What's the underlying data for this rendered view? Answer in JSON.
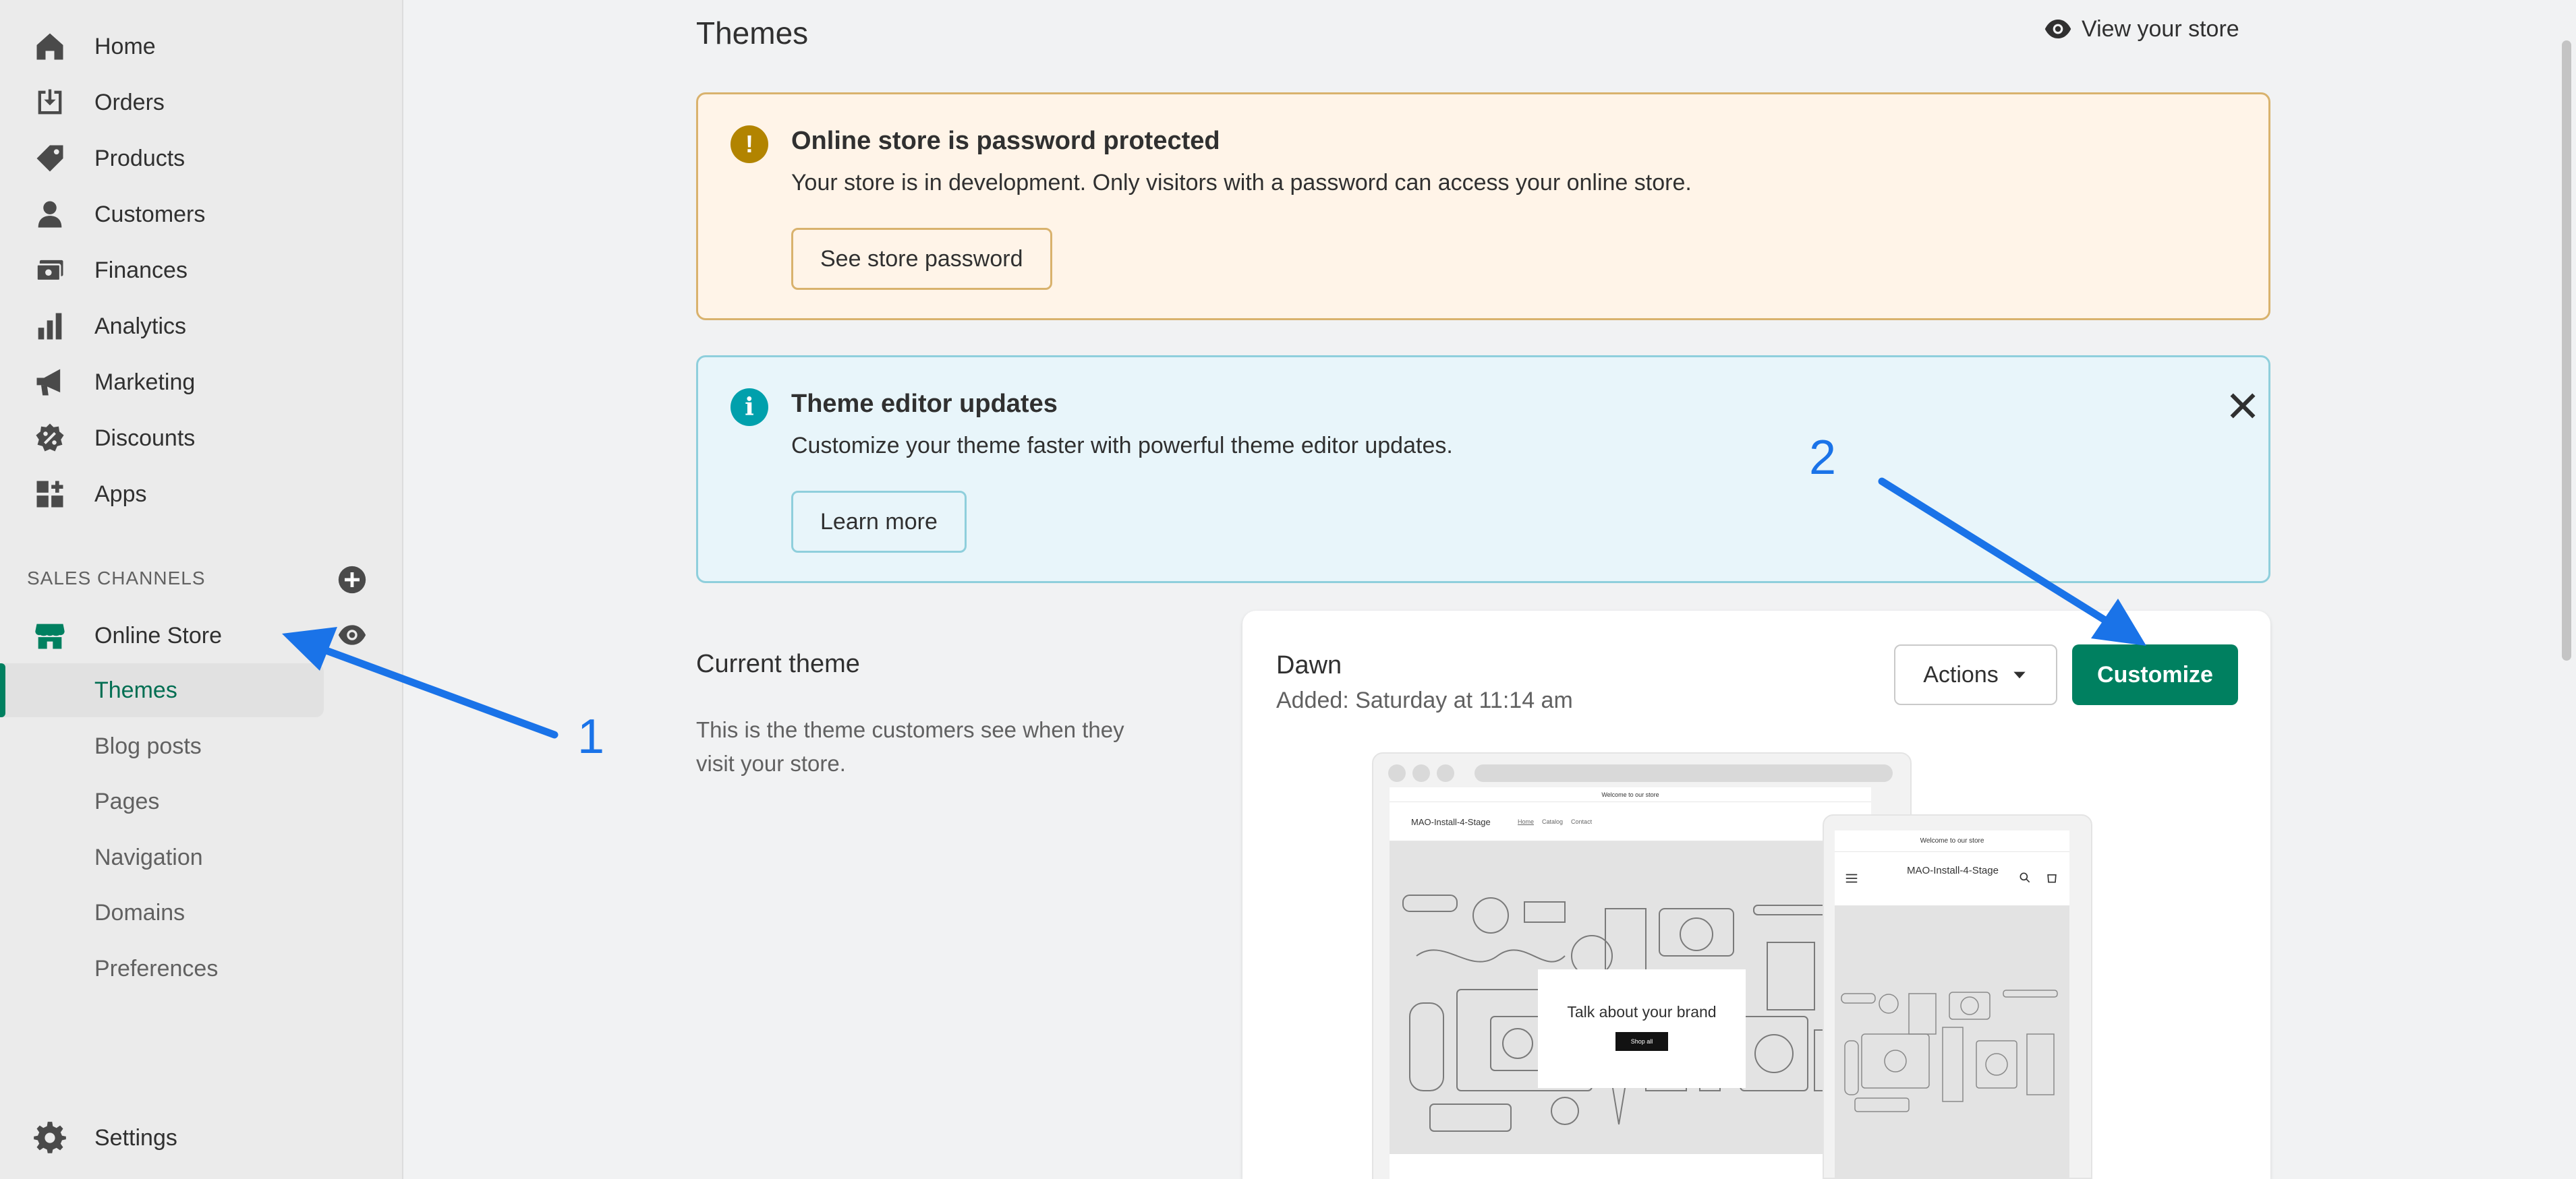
{
  "sidebar": {
    "nav": [
      {
        "label": "Home",
        "icon": "home-icon"
      },
      {
        "label": "Orders",
        "icon": "orders-icon"
      },
      {
        "label": "Products",
        "icon": "tag-icon"
      },
      {
        "label": "Customers",
        "icon": "person-icon"
      },
      {
        "label": "Finances",
        "icon": "finances-icon"
      },
      {
        "label": "Analytics",
        "icon": "bar-chart-icon"
      },
      {
        "label": "Marketing",
        "icon": "megaphone-icon"
      },
      {
        "label": "Discounts",
        "icon": "discount-icon"
      },
      {
        "label": "Apps",
        "icon": "apps-icon"
      }
    ],
    "sales_channels_label": "SALES CHANNELS",
    "online_store_label": "Online Store",
    "sub_items": [
      "Themes",
      "Blog posts",
      "Pages",
      "Navigation",
      "Domains",
      "Preferences"
    ],
    "active_sub_item": "Themes",
    "settings_label": "Settings"
  },
  "header": {
    "title": "Themes",
    "view_store_label": "View your store"
  },
  "password_banner": {
    "title": "Online store is password protected",
    "text": "Your store is in development. Only visitors with a password can access your online store.",
    "button": "See store password",
    "icon": "alert-icon",
    "icon_color": "#b28400"
  },
  "editor_banner": {
    "title": "Theme editor updates",
    "text": "Customize your theme faster with powerful theme editor updates.",
    "button": "Learn more",
    "icon": "info-icon",
    "icon_color": "#00a0ac"
  },
  "current_theme": {
    "section_title": "Current theme",
    "section_desc": "This is the theme customers see when they visit your store.",
    "name": "Dawn",
    "added": "Added: Saturday at 11:14 am",
    "actions_label": "Actions",
    "customize_label": "Customize"
  },
  "preview": {
    "announcement": "Welcome to our store",
    "brand": "MAO-Install-4-Stage",
    "mobile_brand": "MAO-Install-4-Stage",
    "menu": [
      "Home",
      "Catalog",
      "Contact"
    ],
    "hero_text": "Talk about your brand",
    "hero_button": "Shop all"
  },
  "annotations": {
    "one": "1",
    "two": "2"
  },
  "colors": {
    "accent": "#008060",
    "annotation": "#1a73e8"
  }
}
